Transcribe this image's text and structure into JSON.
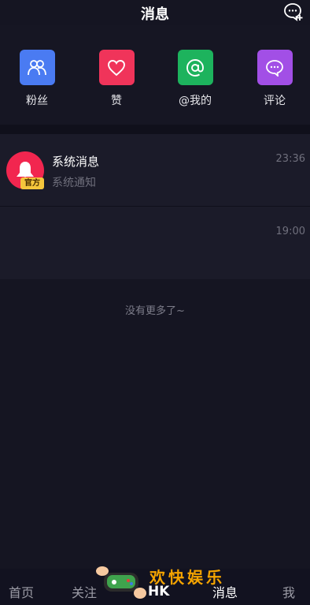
{
  "header": {
    "title": "消息",
    "new_chat_icon": "chat-add-icon"
  },
  "quick_actions": [
    {
      "label": "粉丝",
      "icon": "fans-icon",
      "color": "#4a7bf2"
    },
    {
      "label": "赞",
      "icon": "heart-icon",
      "color": "#f0345a"
    },
    {
      "label": "@我的",
      "icon": "at-icon",
      "color": "#1db35d"
    },
    {
      "label": "评论",
      "icon": "comment-icon",
      "color": "#a24fe6"
    }
  ],
  "messages": [
    {
      "name": "系统消息",
      "subtitle": "系统通知",
      "time": "23:36",
      "badge": "官方",
      "avatar_color": "#f2264f"
    },
    {
      "name": "",
      "subtitle": "",
      "time": "19:00"
    }
  ],
  "list_footer": "没有更多了~",
  "tabbar": {
    "tabs": [
      "首页",
      "关注",
      "",
      "消息",
      "我"
    ],
    "active": "消息"
  },
  "watermark": {
    "text": "欢快娱乐",
    "sub": "HK"
  }
}
